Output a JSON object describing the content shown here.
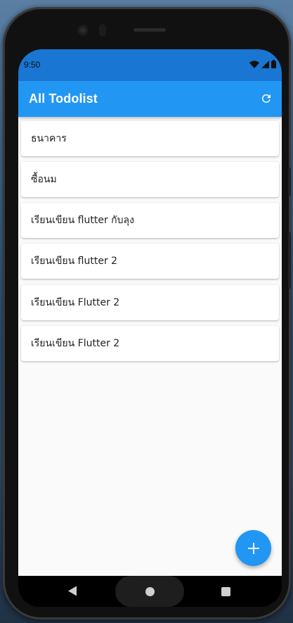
{
  "status_bar": {
    "time": "9:50",
    "icons": [
      "wifi-icon",
      "signal-icon",
      "battery-icon"
    ]
  },
  "app_bar": {
    "title": "All Todolist",
    "refresh_icon": "refresh-icon",
    "background": "#2196F3"
  },
  "todos": [
    {
      "title": "ธนาคาร"
    },
    {
      "title": "ซื้อนม"
    },
    {
      "title": "เรียนเขียน flutter กับลุง"
    },
    {
      "title": "เรียนเขียน flutter 2"
    },
    {
      "title": "เรียนเขียน Flutter 2"
    },
    {
      "title": "เรียนเขียน Flutter 2"
    }
  ],
  "fab": {
    "icon": "add-icon",
    "color": "#2196F3"
  },
  "nav": {
    "back_icon": "back-icon",
    "home_icon": "home-icon",
    "recents_icon": "recents-icon"
  },
  "colors": {
    "status_bar": "#1976D2",
    "background": "#fafafa"
  }
}
